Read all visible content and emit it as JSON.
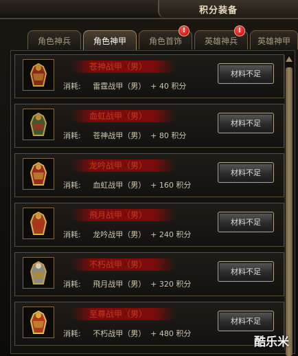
{
  "window": {
    "title": "积分装备"
  },
  "tabs": [
    {
      "label": "角色神兵",
      "active": false,
      "alert": false
    },
    {
      "label": "角色神甲",
      "active": true,
      "alert": false
    },
    {
      "label": "角色首饰",
      "active": false,
      "alert": true
    },
    {
      "label": "英雄神兵",
      "active": false,
      "alert": true
    },
    {
      "label": "英雄神甲",
      "active": false,
      "alert": false
    }
  ],
  "alert_symbol": "!",
  "items": [
    {
      "name": "苍神战甲（男）",
      "cost": "消耗:     雷霆战甲（男）  + 40 积分",
      "button": "材料不足",
      "icon": "armor-icon"
    },
    {
      "name": "血虹战甲（男）",
      "cost": "消耗:     苍神战甲（男）  + 80 积分",
      "button": "材料不足",
      "icon": "armor-icon"
    },
    {
      "name": "龙吟战甲（男）",
      "cost": "消耗:     血虹战甲（男）  + 160 积分",
      "button": "材料不足",
      "icon": "armor-icon"
    },
    {
      "name": "飛月战甲（男）",
      "cost": "消耗:     龙吟战甲（男）  + 240 积分",
      "button": "材料不足",
      "icon": "armor-icon"
    },
    {
      "name": "不朽战甲（男）",
      "cost": "消耗:     飛月战甲（男）  + 320 积分",
      "button": "材料不足",
      "icon": "armor-icon"
    },
    {
      "name": "至尊战甲（男）",
      "cost": "消耗:     不朽战甲（男）  + 480 积分",
      "button": "材料不足",
      "icon": "armor-icon"
    }
  ],
  "watermark": "酷乐米",
  "colors": {
    "accent_red": "#c23a20",
    "alert_red": "#d01010",
    "border_gold": "#9a8660"
  }
}
